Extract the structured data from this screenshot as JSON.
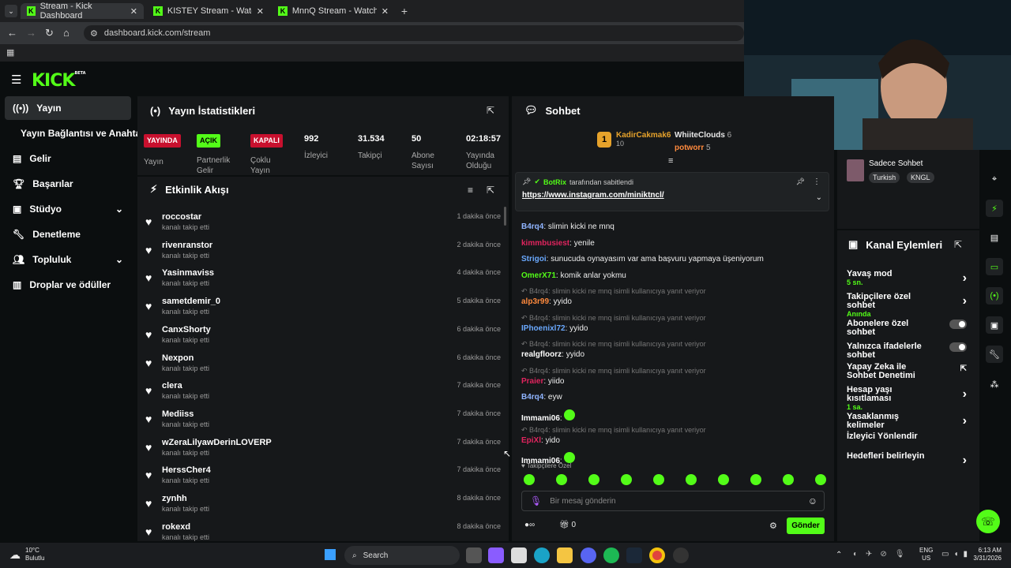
{
  "browser": {
    "tabs": [
      {
        "label": "Stream - Kick Dashboard"
      },
      {
        "label": "KISTEY Stream - Watch Live on"
      },
      {
        "label": "MnnQ Stream - Watch Live on"
      }
    ],
    "url": "dashboard.kick.com/stream"
  },
  "app": {
    "logo": "KICK",
    "logo_tag": "BETA"
  },
  "sidebar": {
    "items": [
      {
        "label": "Yayın"
      },
      {
        "label": "Yayın Bağlantısı ve Anahtarı"
      },
      {
        "label": "Gelir"
      },
      {
        "label": "Başarılar"
      },
      {
        "label": "Stüdyo"
      },
      {
        "label": "Denetleme"
      },
      {
        "label": "Topluluk"
      },
      {
        "label": "Droplar ve ödüller"
      }
    ]
  },
  "stats": {
    "title": "Yayın İstatistikleri",
    "items": [
      {
        "badge": "YAYINDA",
        "label": "Yayın",
        "badge_color": "#c8102e"
      },
      {
        "badge": "AÇIK",
        "label": "Partnerlik Gelir",
        "badge_color": "#53fc18"
      },
      {
        "badge": "KAPALI",
        "label": "Çoklu Yayın",
        "badge_color": "#c8102e"
      },
      {
        "value": "992",
        "label": "İzleyici"
      },
      {
        "value": "31.534",
        "label": "Takipçi"
      },
      {
        "value": "50",
        "label": "Abone Sayısı"
      },
      {
        "value": "02:18:57",
        "label": "Yayında Olduğu"
      }
    ]
  },
  "activity": {
    "title": "Etkinlik Akışı",
    "events": [
      {
        "name": "roccostar",
        "action": "kanalı takip etti",
        "time": "1 dakika önce"
      },
      {
        "name": "rivenranstor",
        "action": "kanalı takip etti",
        "time": "2 dakika önce"
      },
      {
        "name": "Yasinmaviss",
        "action": "kanalı takip etti",
        "time": "4 dakika önce"
      },
      {
        "name": "sametdemir_0",
        "action": "kanalı takip etti",
        "time": "5 dakika önce"
      },
      {
        "name": "CanxShorty",
        "action": "kanalı takip etti",
        "time": "6 dakika önce"
      },
      {
        "name": "Nexpon",
        "action": "kanalı takip etti",
        "time": "6 dakika önce"
      },
      {
        "name": "clera",
        "action": "kanalı takip etti",
        "time": "7 dakika önce"
      },
      {
        "name": "Mediiss",
        "action": "kanalı takip etti",
        "time": "7 dakika önce"
      },
      {
        "name": "wZeraLilyawDerinLOVERP",
        "action": "kanalı takip etti",
        "time": "7 dakika önce"
      },
      {
        "name": "HerssCher4",
        "action": "kanalı takip etti",
        "time": "7 dakika önce"
      },
      {
        "name": "zynhh",
        "action": "kanalı takip etti",
        "time": "8 dakika önce"
      },
      {
        "name": "rokexd",
        "action": "kanalı takip etti",
        "time": "8 dakika önce"
      }
    ]
  },
  "chat": {
    "title": "Sohbet",
    "top_users": [
      {
        "name": "KadirCakmak6",
        "rank": "1",
        "amount": "10"
      },
      {
        "name": "WhiiteClouds",
        "amount": "6"
      },
      {
        "name": "potworr",
        "amount": "5"
      }
    ],
    "pinned": {
      "by": "BotRix",
      "by_suffix": "tarafından sabitlendi",
      "link": "https://www.instagram.com/miniktncl/"
    },
    "messages": [
      {
        "user": "B4rq4",
        "color": "#8fb4ff",
        "text": "slimin kicki ne mnq"
      },
      {
        "user": "kimmbusiest",
        "color": "#e0245e",
        "text": "yenile"
      },
      {
        "user": "Strigoi",
        "color": "#6aa9ff",
        "text": "sunucuda oynayasım var ama başvuru yapmaya üşeniyorum"
      },
      {
        "user": "OmerX71",
        "color": "#53fc18",
        "text": "komik anlar yokmu"
      },
      {
        "reply": "B4rq4: slimin kicki ne mnq isimli kullanıcıya yanıt veriyor",
        "user": "alp3r99",
        "color": "#ff8a3d",
        "text": "yyido"
      },
      {
        "reply": "B4rq4: slimin kicki ne mnq isimli kullanıcıya yanıt veriyor",
        "user": "IPhoenixl72",
        "color": "#6aa9ff",
        "text": "yyido"
      },
      {
        "reply": "B4rq4: slimin kicki ne mnq isimli kullanıcıya yanıt veriyor",
        "user": "realgfloorz",
        "color": "#ffffff",
        "text": "yyido"
      },
      {
        "reply": "B4rq4: slimin kicki ne mnq isimli kullanıcıya yanıt veriyor",
        "user": "Praier",
        "color": "#e0245e",
        "text": "yiido"
      },
      {
        "user": "B4rq4",
        "color": "#8fb4ff",
        "text": "eyw"
      },
      {
        "user": "Immami06",
        "color": "#ffffff",
        "text": ""
      },
      {
        "reply": "B4rq4: slimin kicki ne mnq isimli kullanıcıya yanıt veriyor",
        "user": "EpiXl",
        "color": "#e0245e",
        "text": "yido"
      },
      {
        "user": "Immami06",
        "color": "#ffffff",
        "text": ""
      }
    ],
    "followers_only": "Takipçilere Özel",
    "input_placeholder": "Bir mesaj gönderin",
    "points": "0",
    "send_label": "Gönder"
  },
  "right": {
    "channel": {
      "name": "Sadece Sohbet",
      "tags": [
        "Turkish",
        "KNGL"
      ]
    },
    "actions_title": "Kanal Eylemleri",
    "actions": [
      {
        "label": "Yavaş mod",
        "sub": "5 sn.",
        "control": "chevron"
      },
      {
        "label": "Takipçilere özel sohbet",
        "sub": "Anında",
        "control": "chevron"
      },
      {
        "label": "Abonelere özel sohbet",
        "control": "toggle"
      },
      {
        "label": "Yalnızca ifadelerle sohbet",
        "control": "toggle"
      },
      {
        "label": "Yapay Zeka ile Sohbet Denetimi",
        "control": "external"
      },
      {
        "label": "Hesap yaşı kısıtlaması",
        "sub": "1 sa.",
        "control": "chevron"
      },
      {
        "label": "Yasaklanmış kelimeler",
        "control": "chevron"
      },
      {
        "label": "İzleyici Yönlendir",
        "control": "none"
      },
      {
        "label": "Hedefleri belirleyin",
        "control": "chevron"
      }
    ]
  },
  "taskbar": {
    "weather_temp": "10°C",
    "weather_desc": "Bulutlu",
    "search": "Search",
    "lang": "ENG",
    "region": "US",
    "time": "6:13 AM",
    "date": "3/31/2026"
  },
  "colors": {
    "brand": "#53fc18",
    "live": "#c8102e"
  }
}
